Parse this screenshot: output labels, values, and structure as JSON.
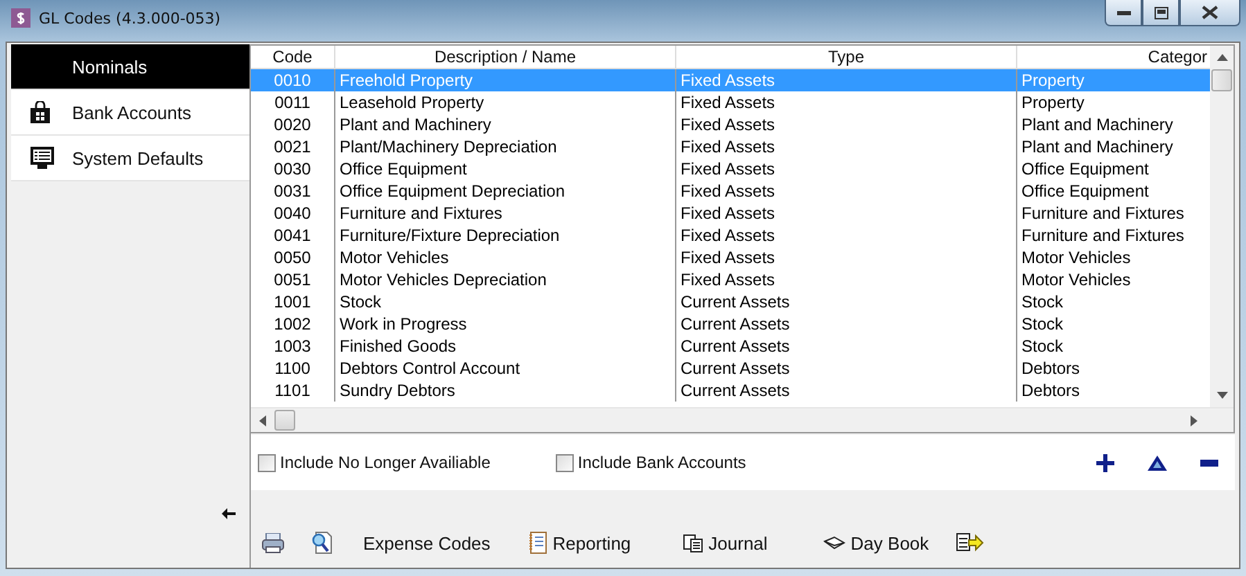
{
  "window": {
    "title": "GL Codes (4.3.000-053)"
  },
  "sidebar": {
    "items": [
      {
        "label": "Nominals",
        "selected": true
      },
      {
        "label": "Bank Accounts",
        "selected": false
      },
      {
        "label": "System Defaults",
        "selected": false
      }
    ]
  },
  "table": {
    "columns": [
      "Code",
      "Description / Name",
      "Type",
      "Categor"
    ],
    "rows": [
      {
        "cells": [
          "0010",
          "Freehold Property",
          "Fixed Assets",
          "Property"
        ],
        "selected": true
      },
      {
        "cells": [
          "0011",
          "Leasehold Property",
          "Fixed Assets",
          "Property"
        ],
        "selected": false
      },
      {
        "cells": [
          "0020",
          "Plant and Machinery",
          "Fixed Assets",
          "Plant and Machinery"
        ],
        "selected": false
      },
      {
        "cells": [
          "0021",
          "Plant/Machinery Depreciation",
          "Fixed Assets",
          "Plant and Machinery"
        ],
        "selected": false
      },
      {
        "cells": [
          "0030",
          "Office Equipment",
          "Fixed Assets",
          "Office Equipment"
        ],
        "selected": false
      },
      {
        "cells": [
          "0031",
          "Office Equipment Depreciation",
          "Fixed Assets",
          "Office Equipment"
        ],
        "selected": false
      },
      {
        "cells": [
          "0040",
          "Furniture and Fixtures",
          "Fixed Assets",
          "Furniture and Fixtures"
        ],
        "selected": false
      },
      {
        "cells": [
          "0041",
          "Furniture/Fixture Depreciation",
          "Fixed Assets",
          "Furniture and Fixtures"
        ],
        "selected": false
      },
      {
        "cells": [
          "0050",
          "Motor Vehicles",
          "Fixed Assets",
          "Motor Vehicles"
        ],
        "selected": false
      },
      {
        "cells": [
          "0051",
          "Motor Vehicles Depreciation",
          "Fixed Assets",
          "Motor Vehicles"
        ],
        "selected": false
      },
      {
        "cells": [
          "1001",
          "Stock",
          "Current Assets",
          "Stock"
        ],
        "selected": false
      },
      {
        "cells": [
          "1002",
          "Work in Progress",
          "Current Assets",
          "Stock"
        ],
        "selected": false
      },
      {
        "cells": [
          "1003",
          "Finished Goods",
          "Current Assets",
          "Stock"
        ],
        "selected": false
      },
      {
        "cells": [
          "1100",
          "Debtors Control Account",
          "Current Assets",
          "Debtors"
        ],
        "selected": false
      },
      {
        "cells": [
          "1101",
          "Sundry Debtors",
          "Current Assets",
          "Debtors"
        ],
        "selected": false
      }
    ]
  },
  "filters": [
    {
      "label": "Include No Longer Availiable",
      "checked": false
    },
    {
      "label": "Include Bank Accounts",
      "checked": false
    }
  ],
  "toolbar": [
    {
      "kind": "print"
    },
    {
      "kind": "preview"
    },
    {
      "kind": "text",
      "label": "Expense Codes"
    },
    {
      "kind": "notebook",
      "label": "Reporting"
    },
    {
      "kind": "copy",
      "label": "Journal"
    },
    {
      "kind": "book",
      "label": "Day Book"
    },
    {
      "kind": "export"
    }
  ]
}
